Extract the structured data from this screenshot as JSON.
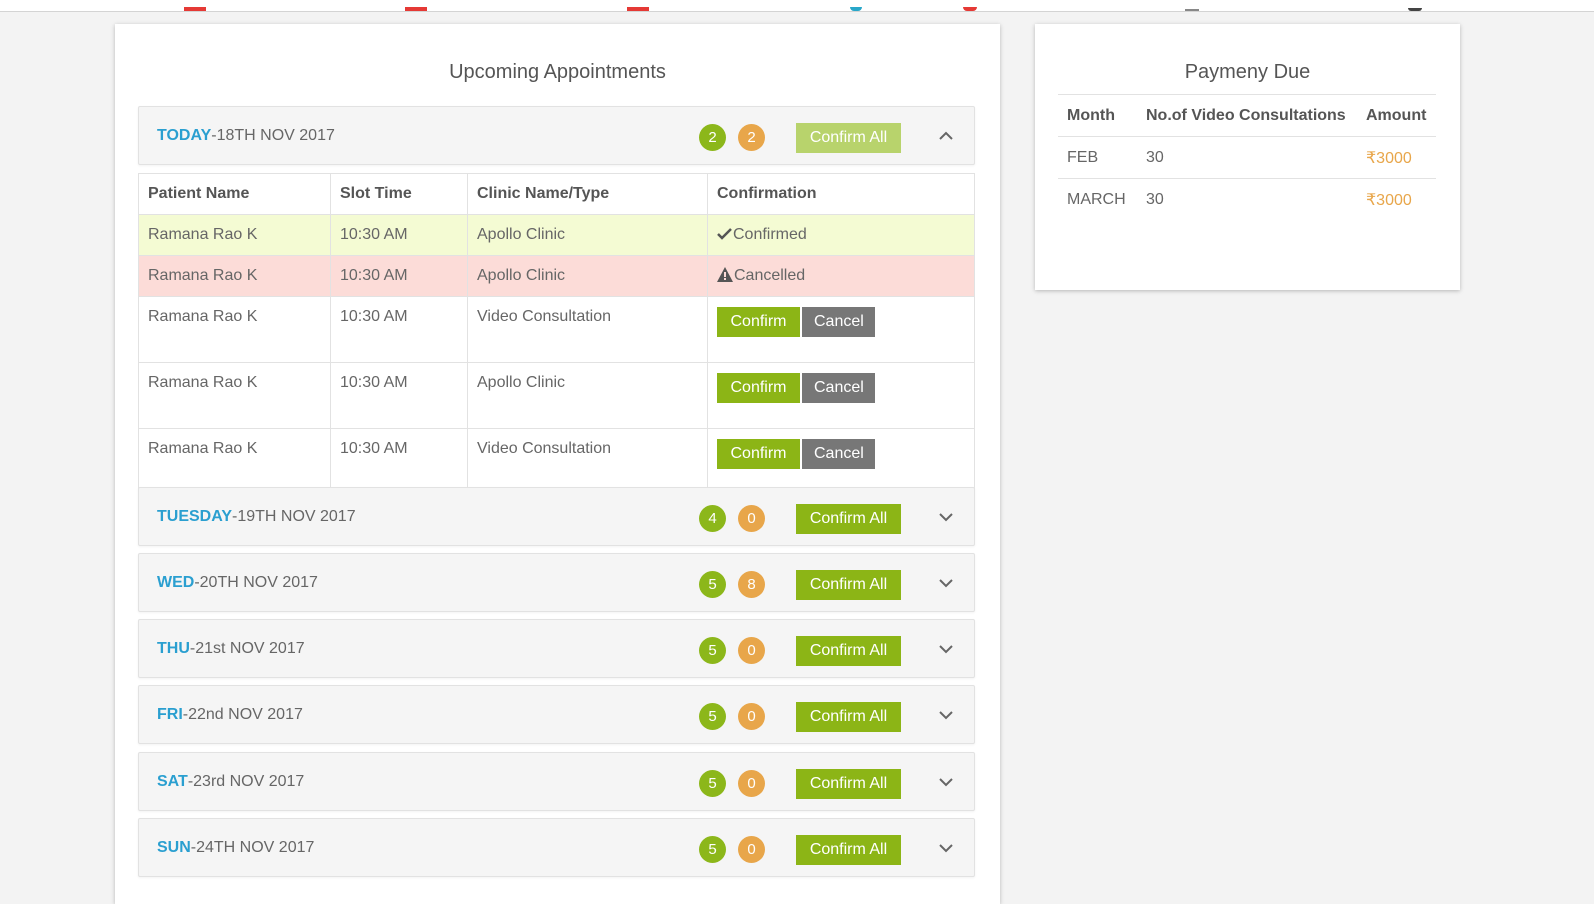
{
  "colors": {
    "accent_blue": "#2a9fd0",
    "green": "#8cb516",
    "orange": "#e8a64a",
    "confirmed_row": "#f4fbd3",
    "cancelled_row": "#fcdcd8"
  },
  "appointments": {
    "title": "Upcoming Appointments",
    "today": {
      "day": "TODAY",
      "date": "-18TH NOV 2017",
      "badge_green": "2",
      "badge_orange": "2",
      "confirm_all": "Confirm All",
      "expanded": true
    },
    "table": {
      "headers": [
        "Patient Name",
        "Slot Time",
        "Clinic Name/Type",
        "Confirmation"
      ],
      "rows": [
        {
          "patient": "Ramana Rao K",
          "time": "10:30 AM",
          "clinic": "Apollo Clinic",
          "status": "Confirmed"
        },
        {
          "patient": "Ramana Rao K",
          "time": "10:30 AM",
          "clinic": "Apollo Clinic",
          "status": "Cancelled"
        },
        {
          "patient": "Ramana Rao K",
          "time": "10:30 AM",
          "clinic": "Video Consultation",
          "confirm": "Confirm",
          "cancel": "Cancel"
        },
        {
          "patient": "Ramana Rao K",
          "time": "10:30 AM",
          "clinic": "Apollo Clinic",
          "confirm": "Confirm",
          "cancel": "Cancel"
        },
        {
          "patient": "Ramana Rao K",
          "time": "10:30 AM",
          "clinic": "Video Consultation",
          "confirm": "Confirm",
          "cancel": "Cancel"
        }
      ]
    },
    "days": [
      {
        "day": "TUESDAY",
        "date": "-19TH NOV 2017",
        "badge_green": "4",
        "badge_orange": "0",
        "confirm_all": "Confirm All"
      },
      {
        "day": "WED",
        "date": "-20TH NOV 2017",
        "badge_green": "5",
        "badge_orange": "8",
        "confirm_all": "Confirm All"
      },
      {
        "day": "THU",
        "date": "-21st NOV 2017",
        "badge_green": "5",
        "badge_orange": "0",
        "confirm_all": "Confirm All"
      },
      {
        "day": "FRI",
        "date": "-22nd NOV 2017",
        "badge_green": "5",
        "badge_orange": "0",
        "confirm_all": "Confirm All"
      },
      {
        "day": "SAT",
        "date": "-23rd NOV 2017",
        "badge_green": "5",
        "badge_orange": "0",
        "confirm_all": "Confirm All"
      },
      {
        "day": "SUN",
        "date": "-24TH NOV 2017",
        "badge_green": "5",
        "badge_orange": "0",
        "confirm_all": "Confirm All"
      }
    ]
  },
  "payment": {
    "title": "Paymeny Due",
    "headers": [
      "Month",
      "No.of Video Consultations",
      "Amount"
    ],
    "rows": [
      {
        "month": "FEB",
        "count": "30",
        "amount": "₹3000"
      },
      {
        "month": "MARCH",
        "count": "30",
        "amount": "₹3000"
      }
    ]
  }
}
